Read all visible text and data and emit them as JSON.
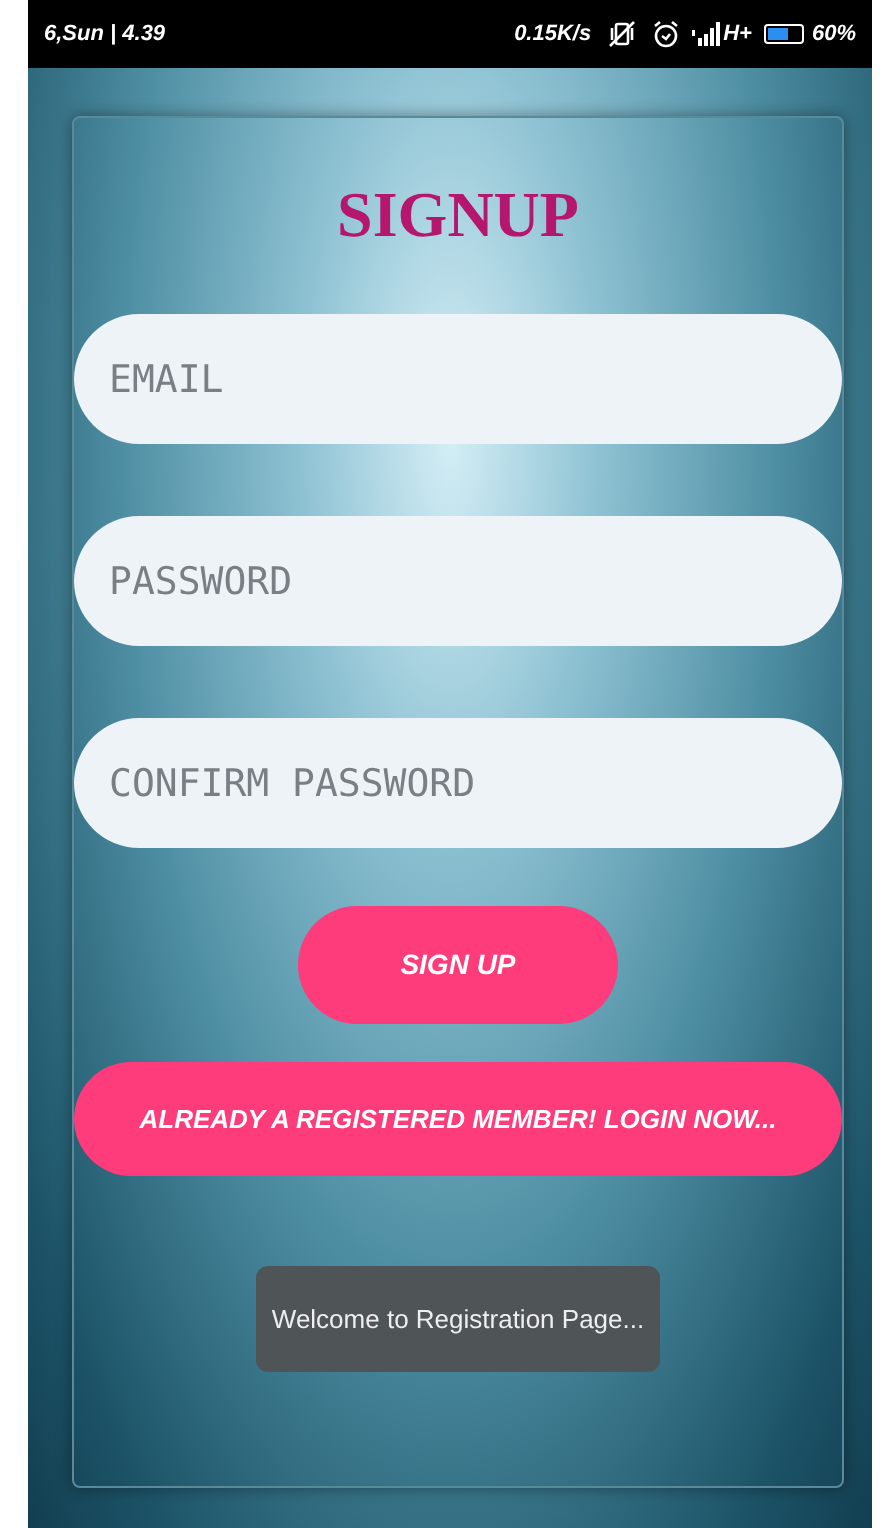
{
  "status_bar": {
    "date_time": "6,Sun | 4.39",
    "speed": "0.15K/s",
    "network": "H+",
    "battery": {
      "level": 0.6,
      "reading": "60%"
    }
  },
  "title": "SIGNUP",
  "fields": [
    {
      "placeholder": "EMAIL"
    },
    {
      "placeholder": "PASSWORD"
    },
    {
      "placeholder": "CONFIRM PASSWORD"
    }
  ],
  "signup_button": "SIGN UP",
  "login_button": "ALREADY A REGISTERED MEMBER! LOGIN NOW...",
  "toast": "Welcome to Registration Page..."
}
